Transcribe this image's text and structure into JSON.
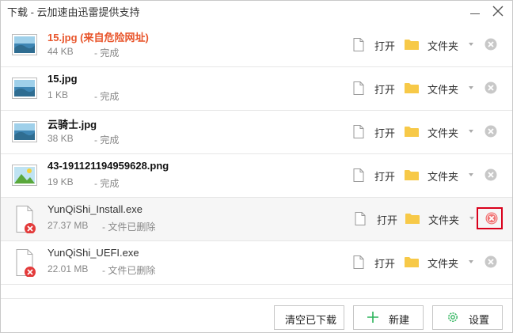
{
  "window": {
    "title": "下载 - 云加速由迅雷提供支持"
  },
  "actions": {
    "open_label": "打开",
    "folder_label": "文件夹"
  },
  "items": [
    {
      "name": "15.jpg (来自危险网址)",
      "size": "44 KB",
      "status": "- 完成",
      "thumb": "image-thumbnail-icon"
    },
    {
      "name": "15.jpg",
      "size": "1 KB",
      "status": "- 完成",
      "thumb": "image-thumbnail-icon"
    },
    {
      "name": "云骑士.jpg",
      "size": "38 KB",
      "status": "- 完成",
      "thumb": "image-thumbnail-icon"
    },
    {
      "name": "43-191121194959628.png",
      "size": "19 KB",
      "status": "- 完成",
      "thumb": "picture-thumbnail-icon"
    },
    {
      "name": "YunQiShi_Install.exe",
      "size": "27.37 MB",
      "status": "- 文件已删除",
      "thumb": "deleted-file-icon"
    },
    {
      "name": "YunQiShi_UEFI.exe",
      "size": "22.01 MB",
      "status": "- 文件已删除",
      "thumb": "deleted-file-icon"
    }
  ],
  "footer": {
    "clear_label": "清空已下载",
    "new_label": "新建",
    "settings_label": "设置"
  },
  "colors": {
    "danger_text": "#e8542a",
    "highlight_box": "#d9001b",
    "accent_green": "#2bb35a",
    "folder": "#f7c948"
  }
}
